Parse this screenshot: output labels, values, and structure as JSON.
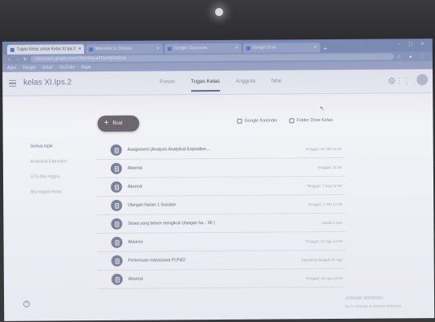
{
  "browser": {
    "tabs": [
      {
        "label": "Tugas Kelas untuk Kelas XI Ips.2"
      },
      {
        "label": "Welcome to Chrome"
      },
      {
        "label": "Google Classroom"
      },
      {
        "label": "Google Drive"
      }
    ],
    "url": "classroom.google.com/c/Mzk5NjcxMTAxMDA5/t/all",
    "bookmarks": [
      "Apps",
      "Google",
      "Gmail",
      "YouTube",
      "Maps"
    ]
  },
  "app": {
    "class_name": "kelas XI.Ips.2",
    "nav_tabs": [
      "Forum",
      "Tugas Kelas",
      "Anggota",
      "Nilai"
    ],
    "create_label": "Buat",
    "calendar_label": "Google Kalender",
    "drive_label": "Folder Drive Kelas"
  },
  "topics": [
    "Semua topik",
    "Analytical Exposition",
    "UTS Bhs Inggris",
    "Bhs Inggris Kelas"
  ],
  "assignments": [
    {
      "title": "Assignment (Analysis Analytical Exposition...",
      "due": "Tenggat: 30 Okt 12.00"
    },
    {
      "title": "Absensi",
      "due": "Tenggat: 12.00"
    },
    {
      "title": "Absensi",
      "due": "Tenggat: 7 Sep 12.00"
    },
    {
      "title": "Ulangan harian 1 Susulan",
      "due": "Tenggat: 4 Okt 14.00"
    },
    {
      "title": "Siswa yang belum mengikuti Ulangan ha... 90 )",
      "due": "Diedit 3 Des"
    },
    {
      "title": "Absensi",
      "due": "Tenggat: 21 Agu 12.00"
    },
    {
      "title": "Pertemuan mahasiswa PLP&D",
      "due": "Diposting tanggal 30 Agu"
    },
    {
      "title": "Absensi",
      "due": "Tenggat: 15 Agu 12.00"
    }
  ],
  "watermark": {
    "title": "Activate Windows",
    "subtitle": "Go to Settings to activate Windows."
  },
  "help_label": "?"
}
